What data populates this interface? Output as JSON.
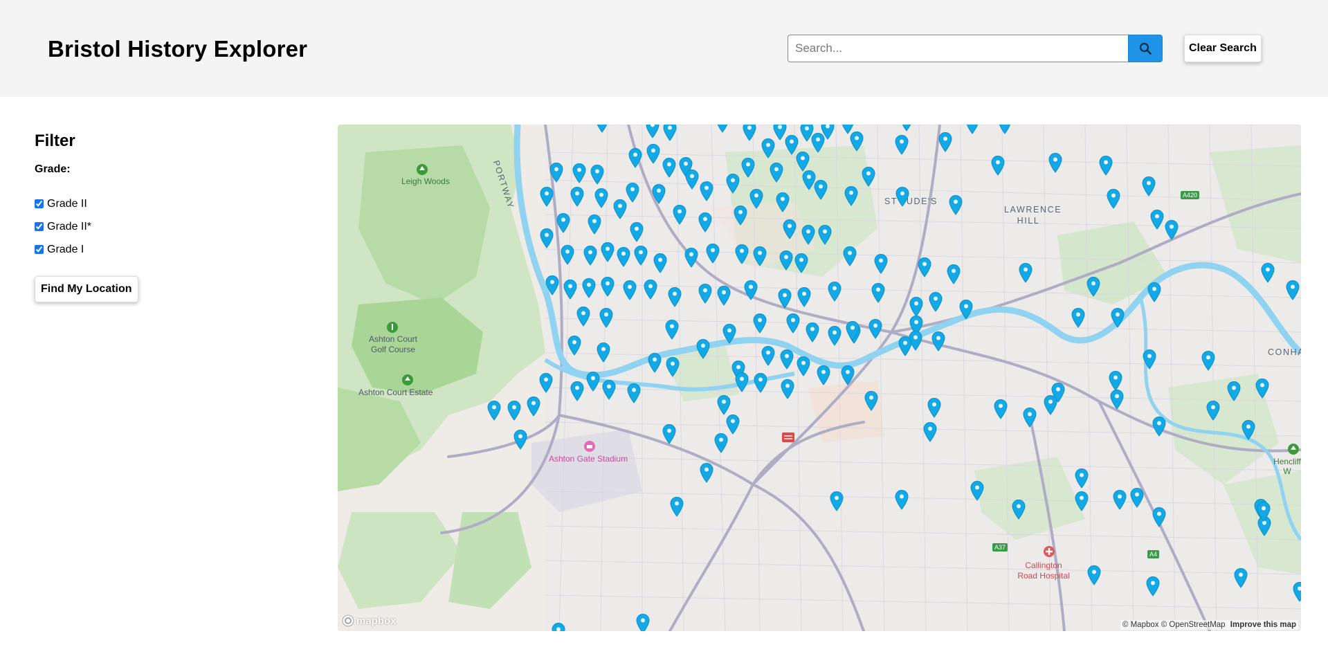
{
  "header": {
    "title": "Bristol History Explorer",
    "search_placeholder": "Search...",
    "clear_label": "Clear Search"
  },
  "sidebar": {
    "filter_title": "Filter",
    "grade_label": "Grade:",
    "grades": [
      {
        "label": "Grade II",
        "checked": true
      },
      {
        "label": "Grade II*",
        "checked": true
      },
      {
        "label": "Grade I",
        "checked": true
      }
    ],
    "locate_label": "Find My Location"
  },
  "map": {
    "labels": {
      "leigh_woods": "Leigh Woods",
      "portway": "PORTWAY",
      "ashton_golf_1": "Ashton Court",
      "ashton_golf_2": "Golf Course",
      "ashton_estate": "Ashton Court Estate",
      "ashton_gate": "Ashton Gate Stadium",
      "st_judes": "ST JUDE'S",
      "lawrence_1": "LAWRENCE",
      "lawrence_2": "HILL",
      "conham": "CONHAM",
      "callington_1": "Callington",
      "callington_2": "Road Hospital",
      "hencliff": "Hencliff W",
      "a420": "A420",
      "a37": "A37",
      "a4": "A4"
    },
    "attribution_text": "© Mapbox © OpenStreetMap",
    "improve_link": "Improve this map",
    "logo_text": "mapbox",
    "marker_color": "#12a9e6"
  }
}
